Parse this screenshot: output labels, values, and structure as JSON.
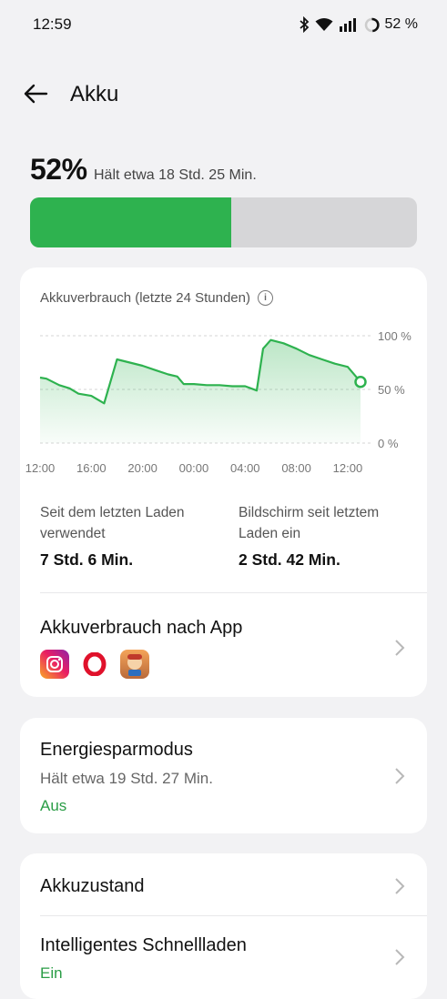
{
  "status_bar": {
    "time": "12:59",
    "battery_text": "52 %"
  },
  "header": {
    "title": "Akku"
  },
  "battery": {
    "percent": "52%",
    "level": 0.52,
    "estimate": "Hält etwa 18 Std. 25 Min."
  },
  "usage_card": {
    "chart_title": "Akkuverbrauch (letzte 24 Stunden)",
    "stat1_label": "Seit dem letzten Laden verwendet",
    "stat1_value": "7 Std. 6 Min.",
    "stat2_label": "Bildschirm seit letztem Laden ein",
    "stat2_value": "2 Std. 42 Min.",
    "by_app_label": "Akkuverbrauch nach App",
    "apps": [
      "instagram-icon",
      "opera-icon",
      "subway-surfers-icon"
    ]
  },
  "chart_data": {
    "type": "area",
    "title": "Akkuverbrauch (letzte 24 Stunden)",
    "x_tick_labels": [
      "12:00",
      "16:00",
      "20:00",
      "00:00",
      "04:00",
      "08:00",
      "12:00"
    ],
    "y_tick_labels": [
      "100 %",
      "50 %",
      "0 %"
    ],
    "ylim": [
      0,
      100
    ],
    "grid": true,
    "series": [
      {
        "color": "#2eb24f",
        "x": [
          12.0,
          12.5,
          13.5,
          14.3,
          15.0,
          16.0,
          17.0,
          18.0,
          19.0,
          20.0,
          21.0,
          22.0,
          22.7,
          23.2,
          24.0,
          25.0,
          26.0,
          27.0,
          28.0,
          28.9,
          29.4,
          30.0,
          31.0,
          32.0,
          33.0,
          34.0,
          35.0,
          36.0,
          37.0
        ],
        "y": [
          61,
          60,
          54,
          51,
          46,
          44,
          37,
          78,
          75,
          72,
          68,
          64,
          62,
          55,
          55,
          54,
          54,
          53,
          53,
          49,
          88,
          96,
          93,
          88,
          82,
          78,
          74,
          71,
          57
        ]
      }
    ]
  },
  "power_saving": {
    "title": "Energiesparmodus",
    "estimate": "Hält etwa 19 Std. 27 Min.",
    "status": "Aus"
  },
  "health": {
    "title": "Akkuzustand"
  },
  "fast_charge": {
    "title": "Intelligentes Schnellladen",
    "status": "Ein"
  }
}
